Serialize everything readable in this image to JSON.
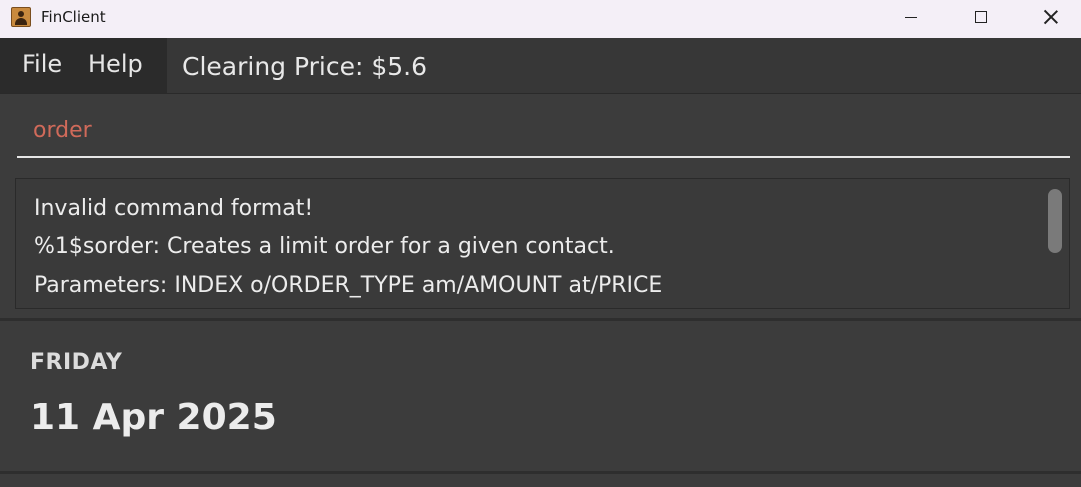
{
  "window": {
    "title": "FinClient",
    "icon": "contacts-book-icon"
  },
  "menu": {
    "file_label": "File",
    "help_label": "Help"
  },
  "status": {
    "clearing_price": "Clearing Price: $5.6"
  },
  "command": {
    "value": "order",
    "text_color": "#d06a5a"
  },
  "result": {
    "lines": [
      "Invalid command format!",
      "%1$sorder: Creates a limit order for a given contact.",
      "Parameters: INDEX o/ORDER_TYPE am/AMOUNT at/PRICE"
    ]
  },
  "date": {
    "day": "FRIDAY",
    "full": "11 Apr 2025"
  }
}
